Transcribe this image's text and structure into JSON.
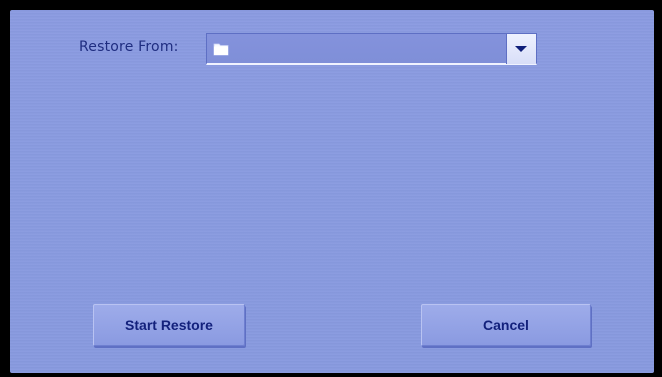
{
  "restore": {
    "label": "Restore From:",
    "selected_value": ""
  },
  "icons": {
    "folder": "folder-icon",
    "dropdown": "chevron-down-icon"
  },
  "buttons": {
    "start_restore": "Start Restore",
    "cancel": "Cancel"
  },
  "colors": {
    "background": "#8b9be1",
    "text": "#1f2d80",
    "button_text": "#13217c"
  }
}
